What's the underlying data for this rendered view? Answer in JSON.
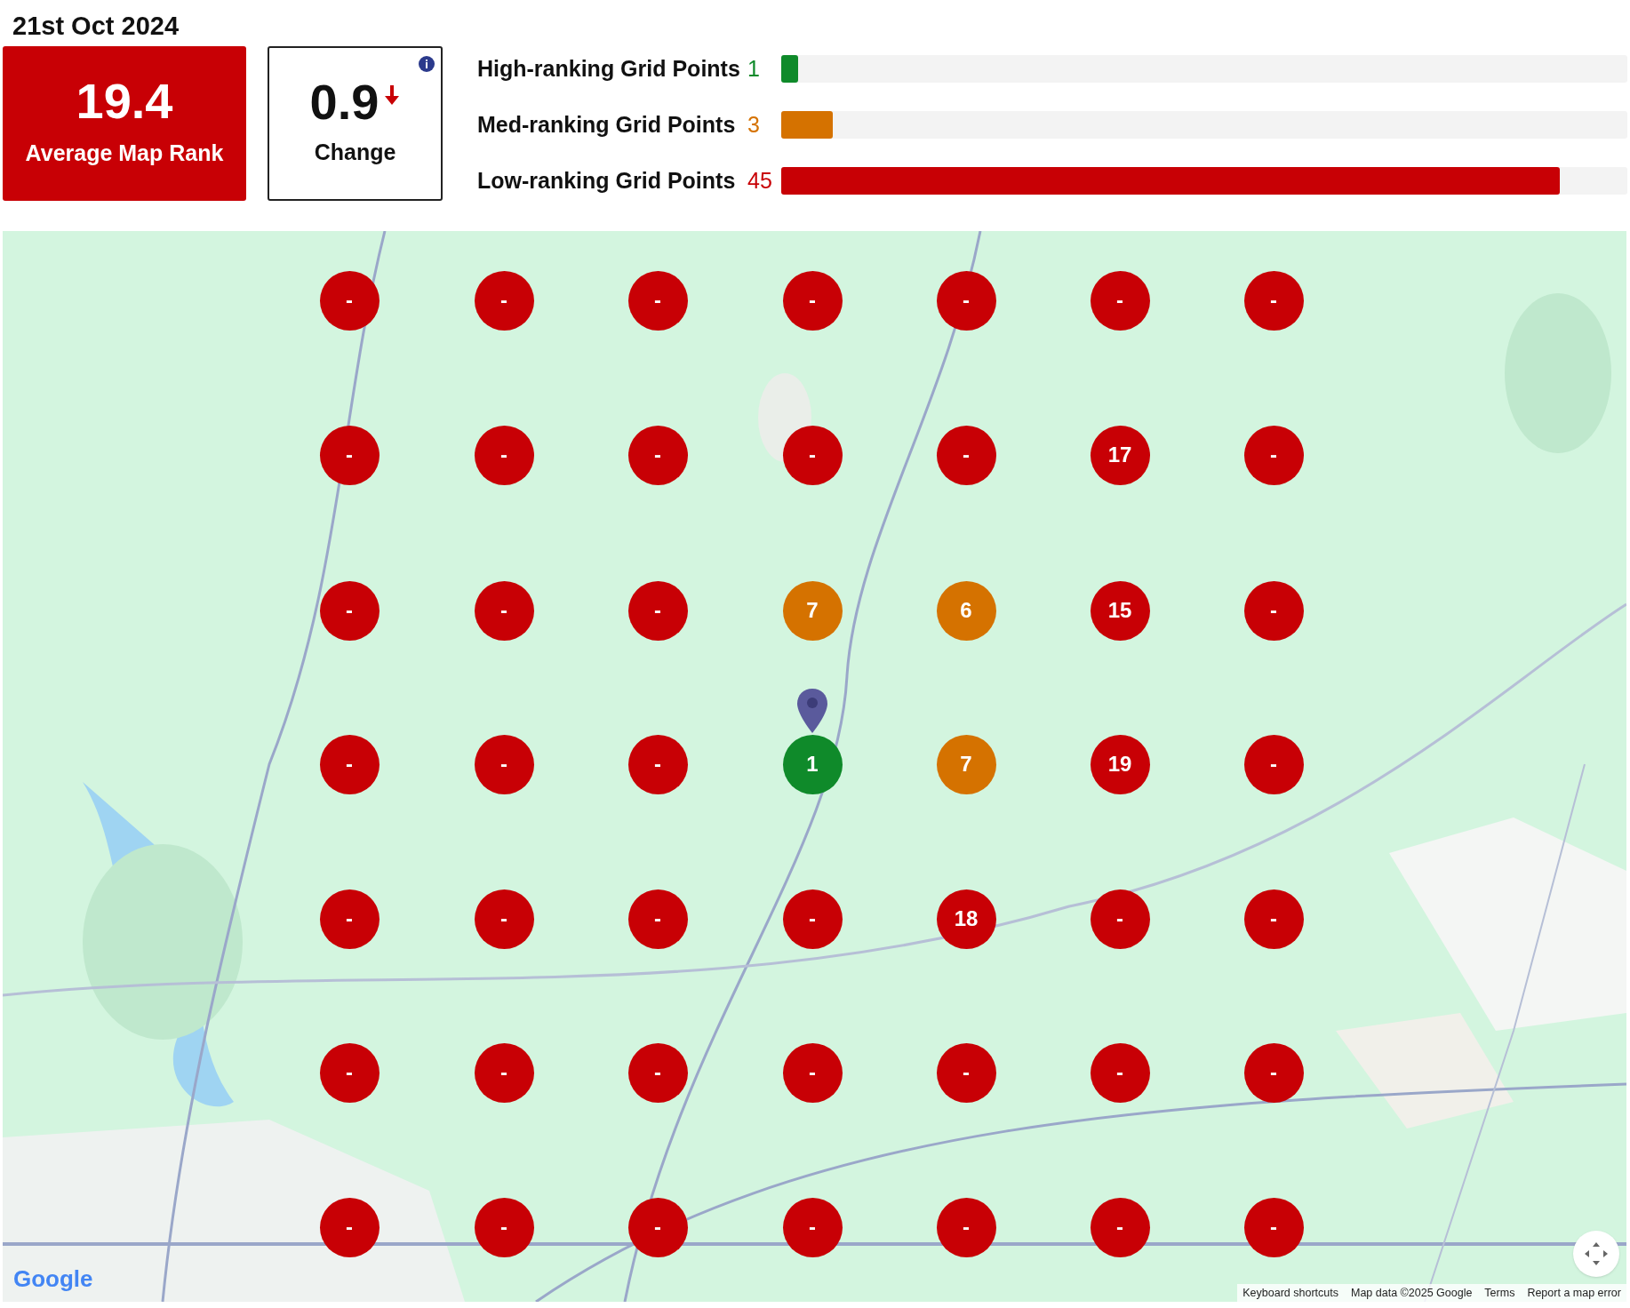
{
  "date": "21st Oct 2024",
  "average": {
    "value": "19.4",
    "label": "Average Map Rank"
  },
  "change": {
    "value": "0.9",
    "decreased": true,
    "label": "Change"
  },
  "rankings": [
    {
      "label": "High-ranking Grid Points",
      "count": "1",
      "kind": "high",
      "level": 0.02
    },
    {
      "label": "Med-ranking Grid Points",
      "count": "3",
      "kind": "med",
      "level": 0.061
    },
    {
      "label": "Low-ranking Grid Points",
      "count": "45",
      "kind": "low",
      "level": 0.92
    }
  ],
  "grid": [
    [
      {
        "rank": "-",
        "kind": "low"
      },
      {
        "rank": "-",
        "kind": "low"
      },
      {
        "rank": "-",
        "kind": "low"
      },
      {
        "rank": "-",
        "kind": "low"
      },
      {
        "rank": "-",
        "kind": "low"
      },
      {
        "rank": "-",
        "kind": "low"
      },
      {
        "rank": "-",
        "kind": "low"
      }
    ],
    [
      {
        "rank": "-",
        "kind": "low"
      },
      {
        "rank": "-",
        "kind": "low"
      },
      {
        "rank": "-",
        "kind": "low"
      },
      {
        "rank": "-",
        "kind": "low"
      },
      {
        "rank": "-",
        "kind": "low"
      },
      {
        "rank": "17",
        "kind": "low"
      },
      {
        "rank": "-",
        "kind": "low"
      }
    ],
    [
      {
        "rank": "-",
        "kind": "low"
      },
      {
        "rank": "-",
        "kind": "low"
      },
      {
        "rank": "-",
        "kind": "low"
      },
      {
        "rank": "7",
        "kind": "med"
      },
      {
        "rank": "6",
        "kind": "med"
      },
      {
        "rank": "15",
        "kind": "low"
      },
      {
        "rank": "-",
        "kind": "low"
      }
    ],
    [
      {
        "rank": "-",
        "kind": "low"
      },
      {
        "rank": "-",
        "kind": "low"
      },
      {
        "rank": "-",
        "kind": "low"
      },
      {
        "rank": "1",
        "kind": "high",
        "pin": true
      },
      {
        "rank": "7",
        "kind": "med"
      },
      {
        "rank": "19",
        "kind": "low"
      },
      {
        "rank": "-",
        "kind": "low"
      }
    ],
    [
      {
        "rank": "-",
        "kind": "low"
      },
      {
        "rank": "-",
        "kind": "low"
      },
      {
        "rank": "-",
        "kind": "low"
      },
      {
        "rank": "-",
        "kind": "low"
      },
      {
        "rank": "18",
        "kind": "low"
      },
      {
        "rank": "-",
        "kind": "low"
      },
      {
        "rank": "-",
        "kind": "low"
      }
    ],
    [
      {
        "rank": "-",
        "kind": "low"
      },
      {
        "rank": "-",
        "kind": "low"
      },
      {
        "rank": "-",
        "kind": "low"
      },
      {
        "rank": "-",
        "kind": "low"
      },
      {
        "rank": "-",
        "kind": "low"
      },
      {
        "rank": "-",
        "kind": "low"
      },
      {
        "rank": "-",
        "kind": "low"
      }
    ],
    [
      {
        "rank": "-",
        "kind": "low"
      },
      {
        "rank": "-",
        "kind": "low"
      },
      {
        "rank": "-",
        "kind": "low"
      },
      {
        "rank": "-",
        "kind": "low"
      },
      {
        "rank": "-",
        "kind": "low"
      },
      {
        "rank": "-",
        "kind": "low"
      },
      {
        "rank": "-",
        "kind": "low"
      }
    ]
  ],
  "map_logo": "Google",
  "attribution": [
    "Keyboard shortcuts",
    "Map data ©2025 Google",
    "Terms",
    "Report a map error"
  ]
}
